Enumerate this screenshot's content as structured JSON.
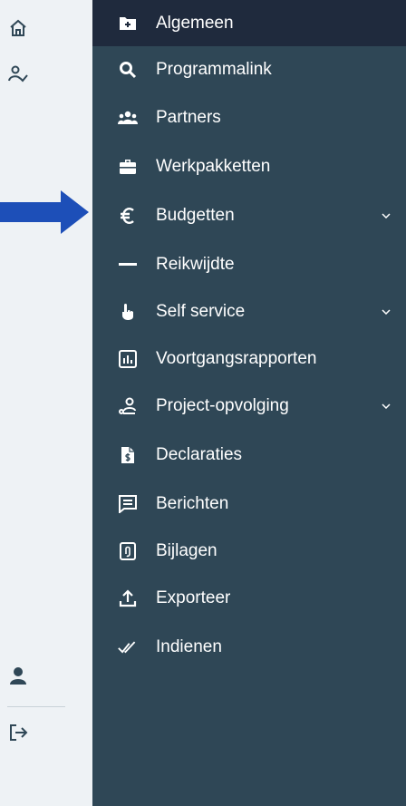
{
  "colors": {
    "rail_bg": "#eef2f5",
    "nav_bg": "#2f4756",
    "active_bg": "#1f2a3d",
    "arrow": "#1d4fb8",
    "text": "#ffffff"
  },
  "rail": {
    "icons": [
      "home-icon",
      "user-check-icon",
      "user-icon",
      "logout-icon"
    ]
  },
  "nav": {
    "items": [
      {
        "label": "Algemeen",
        "icon": "folder-plus-icon",
        "active": true
      },
      {
        "label": "Programmalink",
        "icon": "search-icon"
      },
      {
        "label": "Partners",
        "icon": "users-icon"
      },
      {
        "label": "Werkpakketten",
        "icon": "briefcase-icon"
      },
      {
        "label": "Budgetten",
        "icon": "euro-icon",
        "expandable": true
      },
      {
        "label": "Reikwijdte",
        "icon": "minus-icon"
      },
      {
        "label": "Self service",
        "icon": "hand-pointer-icon",
        "expandable": true
      },
      {
        "label": "Voortgangsrapporten",
        "icon": "chart-icon"
      },
      {
        "label": "Project-opvolging",
        "icon": "user-route-icon",
        "expandable": true
      },
      {
        "label": "Declaraties",
        "icon": "invoice-icon"
      },
      {
        "label": "Berichten",
        "icon": "message-icon"
      },
      {
        "label": "Bijlagen",
        "icon": "attachment-icon"
      },
      {
        "label": "Exporteer",
        "icon": "upload-icon"
      },
      {
        "label": "Indienen",
        "icon": "double-check-icon"
      }
    ]
  }
}
